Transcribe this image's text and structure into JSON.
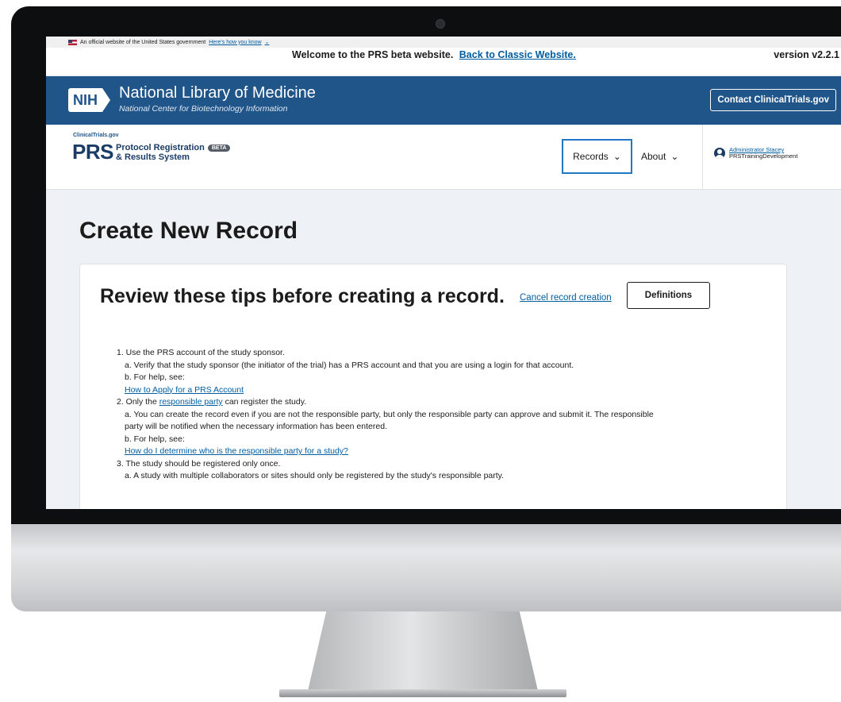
{
  "gov_banner": {
    "text": "An official website of the United States government",
    "link": "Here's how you know"
  },
  "welcome": {
    "text": "Welcome to the PRS beta website.",
    "link": "Back to Classic Website.",
    "version": "version v2.2.1"
  },
  "nih_header": {
    "logo": "NIH",
    "title": "National Library of Medicine",
    "subtitle": "National Center for Biotechnology Information",
    "contact_button": "Contact ClinicalTrials.gov"
  },
  "prs_header": {
    "small_label": "ClinicalTrials.gov",
    "brand": "PRS",
    "line1": "Protocol Registration",
    "beta": "BETA",
    "line2": "& Results System",
    "nav": {
      "records": "Records",
      "about": "About"
    },
    "user": {
      "name": "Administrator Stacey",
      "org": "PRSTrainingDevelopment"
    }
  },
  "main": {
    "page_title": "Create New Record",
    "card_heading": "Review these tips before creating a record.",
    "cancel_link": "Cancel record creation",
    "definitions_button": "Definitions"
  },
  "tips": {
    "t1": "1. Use the PRS account of the study sponsor.",
    "t1a": "a. Verify that the study sponsor (the initiator of the trial) has a PRS account and that you are using a login for that account.",
    "t1b": "b. For help, see:",
    "t1link": "How to Apply for a PRS Account",
    "t2_prefix": "2. Only the",
    "t2_link": "responsible party",
    "t2_suffix": "can register the study.",
    "t2a_line1": "a. You can create the record even if you are not the responsible party, but only the responsible party can approve and submit it. The responsible",
    "t2a_line2": "party will be notified when the necessary information has been entered.",
    "t2b": "b. For help, see:",
    "t2link": "How do I determine who is the responsible party for a study?",
    "t3": "3. The study should be registered only once.",
    "t3a": "a. A study with multiple collaborators or sites should only be registered by the study's responsible party."
  }
}
